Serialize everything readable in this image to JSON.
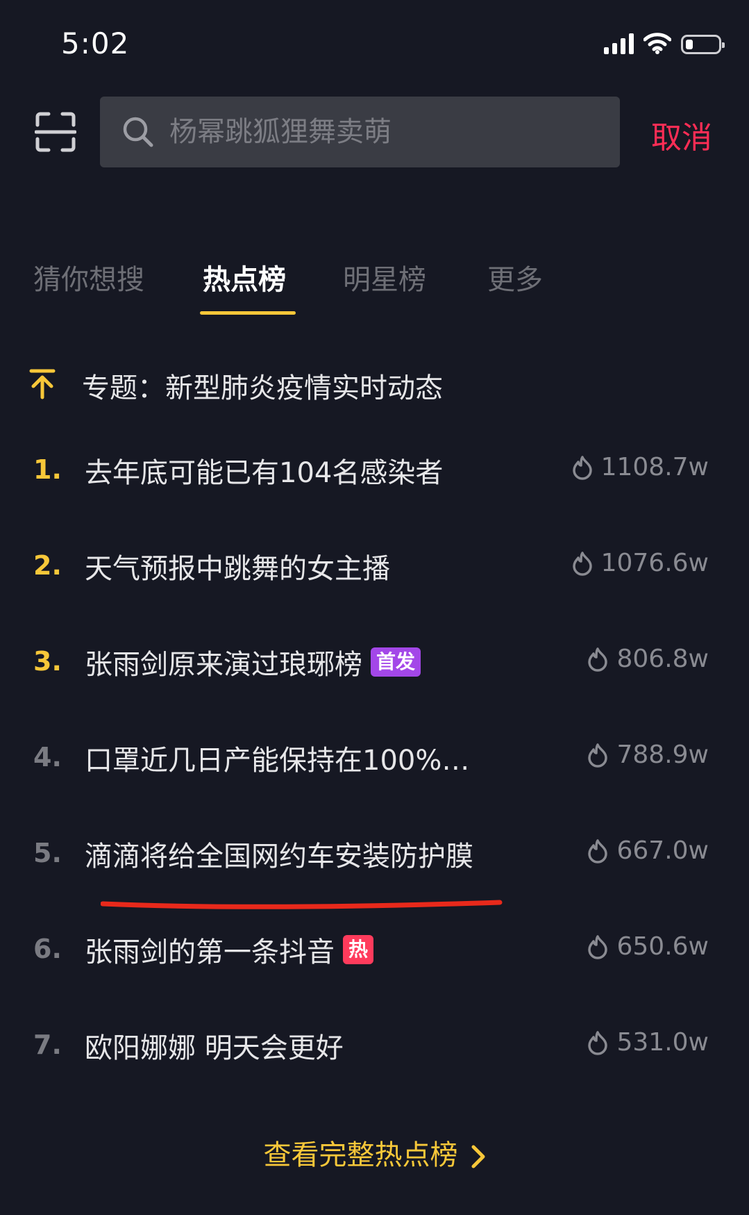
{
  "status": {
    "time": "5:02",
    "battery_level": 0.22
  },
  "search": {
    "placeholder": "杨幂跳狐狸舞卖萌",
    "cancel_label": "取消"
  },
  "tabs": [
    {
      "label": "猜你想搜",
      "active": false
    },
    {
      "label": "热点榜",
      "active": true
    },
    {
      "label": "明星榜",
      "active": false
    },
    {
      "label": "更多",
      "active": false
    }
  ],
  "topic": {
    "text": "专题：新型肺炎疫情实时动态"
  },
  "hot_list": [
    {
      "rank": "1.",
      "title": "去年底可能已有104名感染者",
      "heat": "1108.7w",
      "badge": null
    },
    {
      "rank": "2.",
      "title": "天气预报中跳舞的女主播",
      "heat": "1076.6w",
      "badge": null
    },
    {
      "rank": "3.",
      "title": "张雨剑原来演过琅琊榜",
      "heat": "806.8w",
      "badge": "首发"
    },
    {
      "rank": "4.",
      "title": "口罩近几日产能保持在100%…",
      "heat": "788.9w",
      "badge": null
    },
    {
      "rank": "5.",
      "title": "滴滴将给全国网约车安装防护膜",
      "heat": "667.0w",
      "badge": null
    },
    {
      "rank": "6.",
      "title": "张雨剑的第一条抖音",
      "heat": "650.6w",
      "badge": "热"
    },
    {
      "rank": "7.",
      "title": "欧阳娜娜 明天会更好",
      "heat": "531.0w",
      "badge": null
    }
  ],
  "view_all_label": "查看完整热点榜",
  "colors": {
    "background": "#161823",
    "accent_yellow": "#f7c739",
    "cancel_red": "#ff2d55",
    "badge_first": "#a347e8",
    "badge_hot": "#ff3b5c",
    "annotation_red": "#e8291b"
  },
  "icons": {
    "scan": "scan-icon",
    "search": "search-icon",
    "pin": "pin-top-icon",
    "heat": "flame-icon",
    "chevron": "chevron-right-icon"
  }
}
